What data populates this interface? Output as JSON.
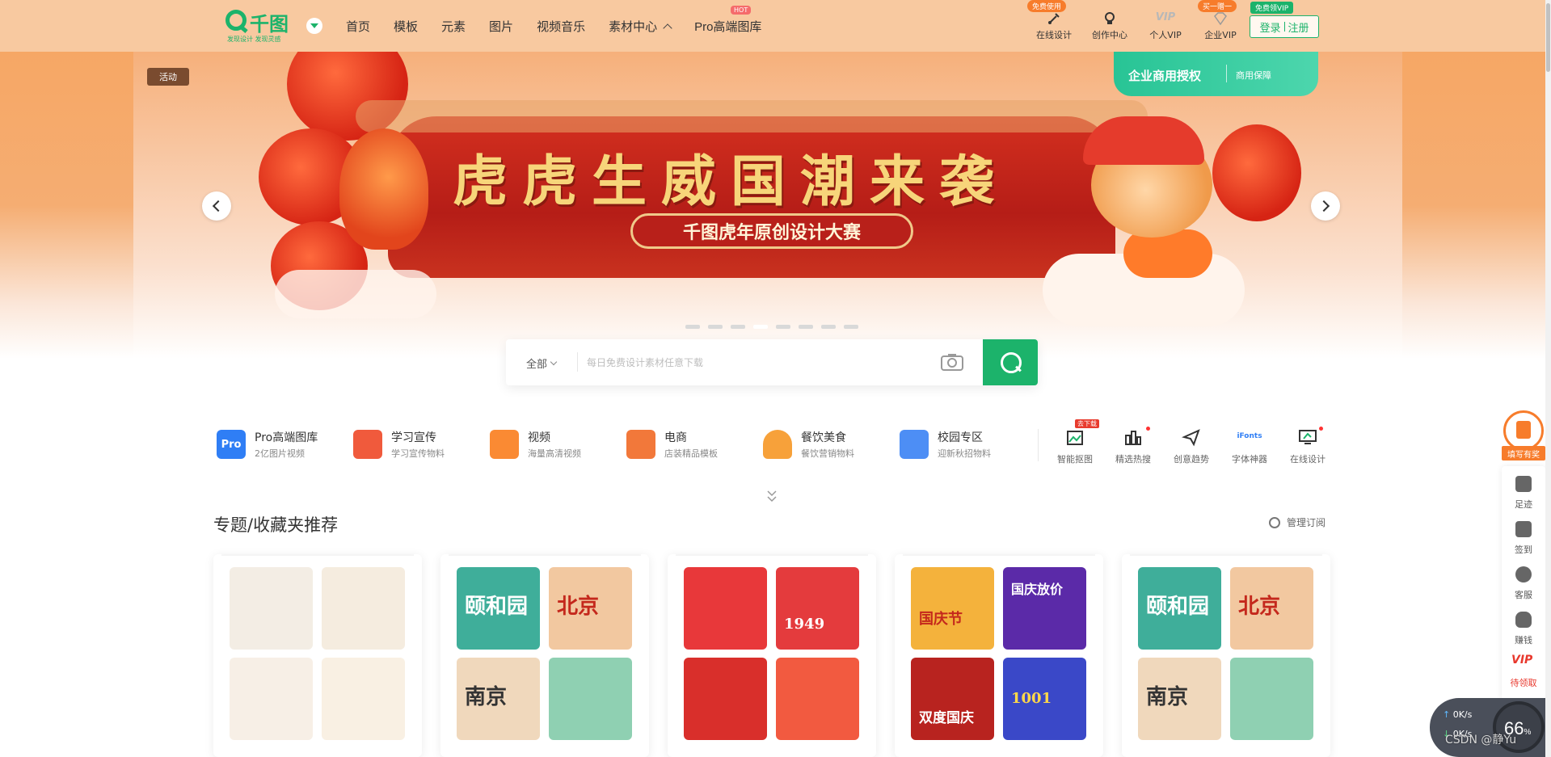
{
  "header": {
    "brand": "千图",
    "slogan": "发现设计 发现灵感",
    "nav": [
      "首页",
      "模板",
      "元素",
      "图片",
      "视频音乐",
      "素材中心",
      "Pro高端图库"
    ],
    "hot_badge": "HOT",
    "right_items": [
      {
        "label": "在线设计",
        "badge": "免费使用",
        "icon": "pen-icon"
      },
      {
        "label": "创作中心",
        "icon": "bulb-icon"
      },
      {
        "label": "个人VIP",
        "icon": "vip-icon"
      },
      {
        "label": "企业VIP",
        "badge": "买一赠一",
        "icon": "diamond-icon"
      }
    ],
    "free_vip_badge": "免费领VIP",
    "login": "登录",
    "register": "注册"
  },
  "banner": {
    "tag": "活动",
    "title": "虎虎生威国潮来袭",
    "subtitle": "千图虎年原创设计大赛",
    "biz_main": "企业商用授权",
    "biz_sub": "商用保障",
    "slide_count": 8,
    "active_slide": 4
  },
  "search": {
    "scope": "全部",
    "placeholder": "每日免费设计素材任意下载"
  },
  "categories": [
    {
      "title": "Pro高端图库",
      "sub": "2亿图片视频",
      "color": "#2f7ef5"
    },
    {
      "title": "学习宣传",
      "sub": "学习宣传物料",
      "color": "#f05a3c"
    },
    {
      "title": "视频",
      "sub": "海量高清视频",
      "color": "#fa8a33"
    },
    {
      "title": "电商",
      "sub": "店装精品模板",
      "color": "#f2783a"
    },
    {
      "title": "餐饮美食",
      "sub": "餐饮营销物料",
      "color": "#f7a13a"
    },
    {
      "title": "校园专区",
      "sub": "迎新秋招物料",
      "color": "#4d8ef5"
    }
  ],
  "tools": [
    {
      "label": "智能抠图",
      "badge": "去下载"
    },
    {
      "label": "精选热搜"
    },
    {
      "label": "创意趋势"
    },
    {
      "label": "字体神器",
      "icon_text": "iFonts"
    },
    {
      "label": "在线设计"
    }
  ],
  "section": {
    "title": "专题/收藏夹推荐",
    "manage": "管理订阅"
  },
  "cards": [
    {
      "thumbs": [
        {
          "bg": "#f3ede4",
          "text": ""
        },
        {
          "bg": "#f5ecdf",
          "text": ""
        },
        {
          "bg": "#f7efe6",
          "text": ""
        },
        {
          "bg": "#f9f0e3",
          "text": ""
        }
      ]
    },
    {
      "thumbs": [
        {
          "bg": "#3fae9a",
          "text": "颐和园"
        },
        {
          "bg": "#f2c8a0",
          "text": "北京"
        },
        {
          "bg": "#f0d8bc",
          "text": "南京"
        },
        {
          "bg": "#8fd0b2",
          "text": ""
        }
      ]
    },
    {
      "thumbs": [
        {
          "bg": "#e8383a",
          "text": ""
        },
        {
          "bg": "#e43b3d",
          "text": "1949"
        },
        {
          "bg": "#d92f2b",
          "text": ""
        },
        {
          "bg": "#f25a40",
          "text": ""
        }
      ]
    },
    {
      "thumbs": [
        {
          "bg": "#f4b23c",
          "text": "国庆节"
        },
        {
          "bg": "#5b2aa8",
          "text": "国庆放价"
        },
        {
          "bg": "#b8231f",
          "text": "双度国庆"
        },
        {
          "bg": "#3a48c8",
          "text": "1001"
        }
      ]
    },
    {
      "thumbs": [
        {
          "bg": "#3fae9a",
          "text": "颐和园"
        },
        {
          "bg": "#f2c8a0",
          "text": "北京"
        },
        {
          "bg": "#f0d8bc",
          "text": "南京"
        },
        {
          "bg": "#8fd0b2",
          "text": ""
        }
      ]
    }
  ],
  "sidebar": {
    "fill_label": "填写有奖",
    "items": [
      "足迹",
      "签到",
      "客服",
      "赚钱"
    ],
    "vip_icon": "VIP",
    "vip_label": "待领取"
  },
  "net_widget": {
    "up": "0",
    "down": "0",
    "unit": "K/s",
    "percent": "66",
    "percent_sign": "%"
  },
  "watermark": "CSDN @静Yu"
}
